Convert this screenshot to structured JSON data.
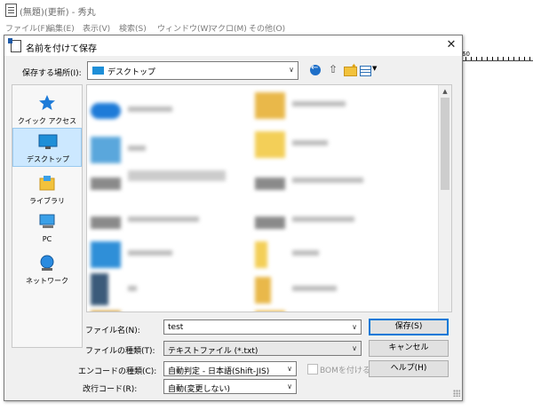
{
  "app": {
    "title": "(無題)(更新) - 秀丸",
    "menu": [
      "ファイル(F)",
      "編集(E)",
      "表示(V)",
      "検索(S)",
      "ウィンドウ(W)",
      "マクロ(M)",
      "その他(O)"
    ],
    "ruler_number": "60"
  },
  "dialog": {
    "title": "名前を付けて保存",
    "close": "✕",
    "location_label": "保存する場所(I):",
    "location_value": "デスクトップ",
    "places": [
      {
        "label": "クイック アクセス",
        "icon": "star-icon"
      },
      {
        "label": "デスクトップ",
        "icon": "desktop-icon",
        "selected": true
      },
      {
        "label": "ライブラリ",
        "icon": "library-icon"
      },
      {
        "label": "PC",
        "icon": "pc-icon"
      },
      {
        "label": "ネットワーク",
        "icon": "network-icon"
      }
    ],
    "filename_label": "ファイル名(N):",
    "filename_value": "test",
    "filetype_label": "ファイルの種類(T):",
    "filetype_value": "テキストファイル (*.txt)",
    "encoding_label": "エンコードの種類(C):",
    "encoding_value": "自動判定 - 日本語(Shift-JIS)",
    "bom_label": "BOMを付ける",
    "newline_label": "改行コード(R):",
    "newline_value": "自動(変更しない)",
    "save_button": "保存(S)",
    "cancel_button": "キャンセル",
    "help_button": "ヘルプ(H)"
  },
  "colors": {
    "accent": "#0078d7",
    "selection": "#cce8ff",
    "folder": "#f2c23c",
    "onedrive": "#1e6fc8"
  }
}
